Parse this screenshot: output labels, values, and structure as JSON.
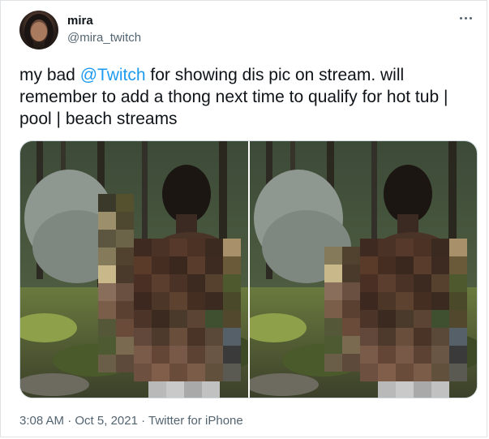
{
  "tweet": {
    "display_name": "mira",
    "handle": "@mira_twitch",
    "text_before": "my bad ",
    "mention": "@Twitch",
    "text_after": " for showing dis pic on stream. will remember to add a thong next time to qualify for hot tub | pool | beach streams",
    "time": "3:08 AM",
    "separator": " · ",
    "date": "Oct 5, 2021",
    "source": "Twitter for iPhone"
  },
  "icons": {
    "more": "more-horizontal-icon"
  },
  "media": {
    "count": 2
  },
  "colors": {
    "accent": "#1d9bf0",
    "text_primary": "#0f1419",
    "text_secondary": "#536471"
  }
}
